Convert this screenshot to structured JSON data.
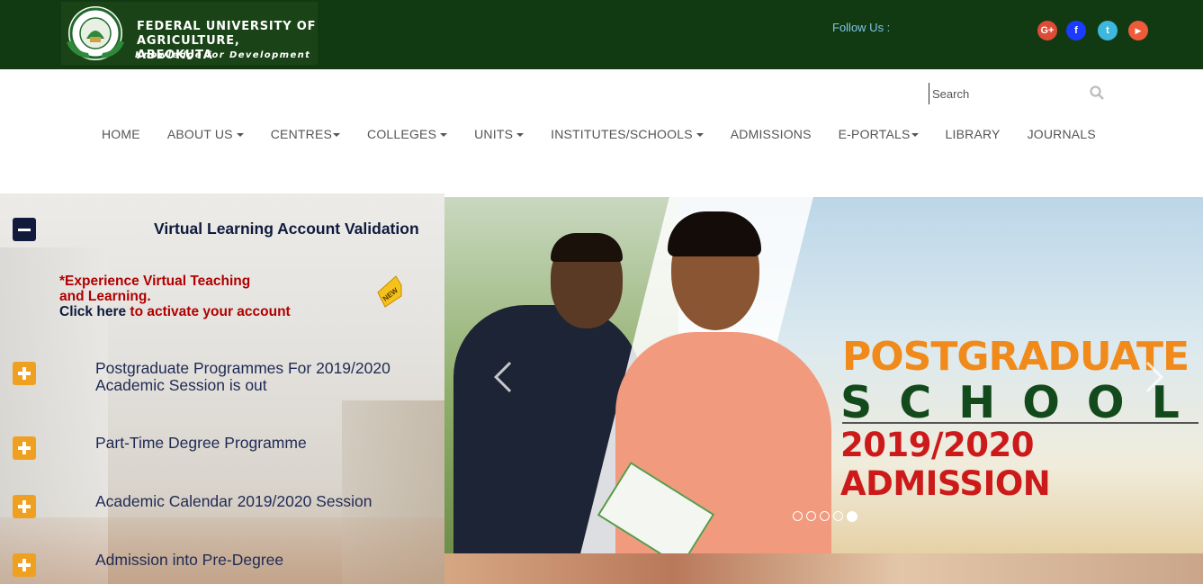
{
  "header": {
    "logo_line1": "FEDERAL UNIVERSITY OF",
    "logo_line2": "AGRICULTURE, ABEOKUTA",
    "logo_motto": "Knowledge for Development",
    "follow_label": "Follow Us :",
    "social": [
      {
        "name": "google-plus",
        "glyph": "G+",
        "color": "#dd4b39"
      },
      {
        "name": "facebook",
        "glyph": "f",
        "color": "#1b3bff"
      },
      {
        "name": "twitter",
        "glyph": "t",
        "color": "#3bb7e0"
      },
      {
        "name": "youtube",
        "glyph": "▶",
        "color": "#ee5a3a"
      }
    ],
    "bg_color": "#123a12"
  },
  "search": {
    "placeholder": "Search"
  },
  "nav": {
    "items": [
      {
        "label": "HOME",
        "dropdown": false
      },
      {
        "label": "ABOUT US",
        "dropdown": true
      },
      {
        "label": "CENTRES",
        "dropdown": true
      },
      {
        "label": "COLLEGES",
        "dropdown": true
      },
      {
        "label": "UNITS",
        "dropdown": true
      },
      {
        "label": "INSTITUTES/SCHOOLS",
        "dropdown": true
      },
      {
        "label": "ADMISSIONS",
        "dropdown": false
      },
      {
        "label": "E-PORTALS",
        "dropdown": true
      },
      {
        "label": "LIBRARY",
        "dropdown": false
      },
      {
        "label": "JOURNALS",
        "dropdown": false
      }
    ]
  },
  "accordion": {
    "open_title": "Virtual Learning Account Validation",
    "open_body": {
      "line1": "*Experience Virtual Teaching",
      "line2": "and Learning.",
      "link_text": "Click here",
      "link_suffix": " to activate your account",
      "badge": "NEW"
    },
    "items": [
      {
        "line1": "Postgraduate Programmes For 2019/2020",
        "line2": "Academic Session is out"
      },
      {
        "line1": "Part-Time Degree Programme",
        "line2": ""
      },
      {
        "line1": "Academic Calendar 2019/2020 Session",
        "line2": ""
      },
      {
        "line1": "Admission into Pre-Degree",
        "line2": ""
      }
    ]
  },
  "carousel": {
    "slide_line1": "POSTGRADUATE",
    "slide_line2": "SCHOOL",
    "slide_line3": "2019/2020 ADMISSION",
    "slide_count": 5,
    "active_slide": 5
  }
}
